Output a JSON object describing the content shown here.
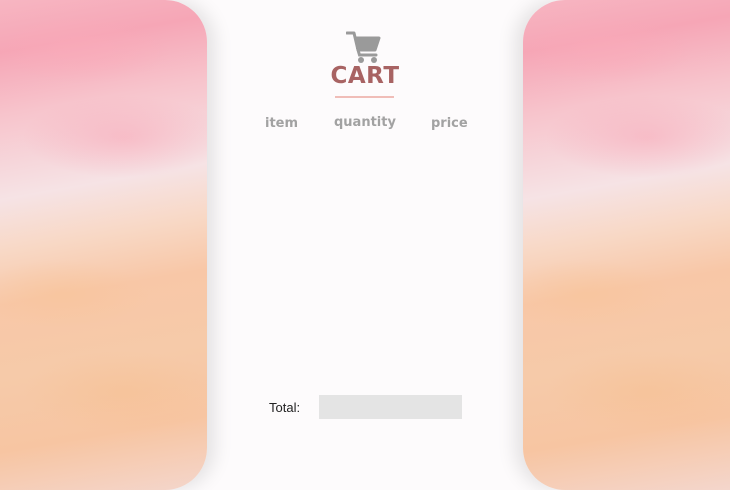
{
  "page": {
    "title": "CART",
    "cart_icon": "shopping-cart-icon"
  },
  "columns": {
    "item": "item",
    "quantity": "quantity",
    "price": "price"
  },
  "items": [],
  "total": {
    "label": "Total:",
    "value": ""
  },
  "colors": {
    "title": "#a86363",
    "underline": "#f0bdb8",
    "header_text": "#a2a2a2",
    "total_field_bg": "#e4e4e4",
    "icon": "#9a9a9a"
  }
}
